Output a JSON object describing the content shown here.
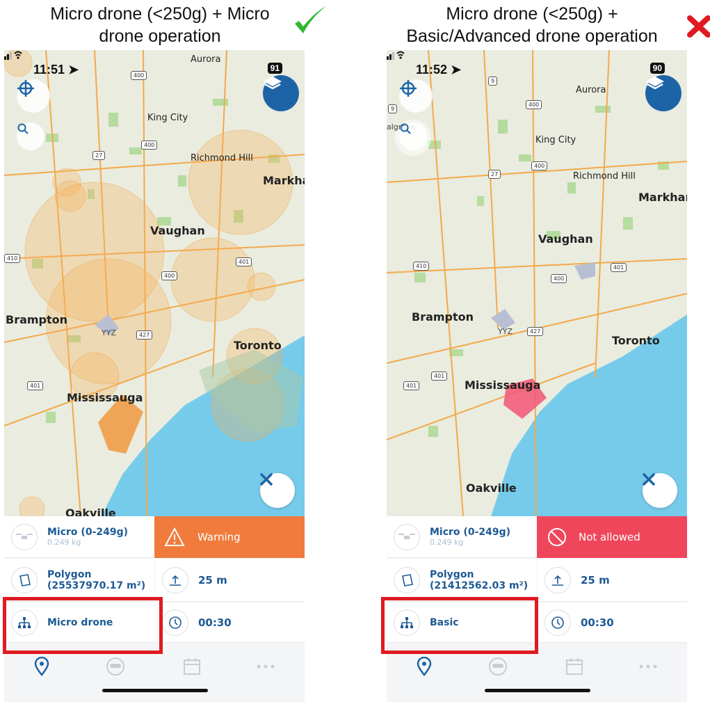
{
  "captions": {
    "left": "Micro drone (<250g) + Micro drone operation",
    "right": "Micro drone (<250g) + Basic/Advanced drone operation"
  },
  "colors": {
    "accent_blue": "#1d64a6",
    "label_blue": "#1d5a94",
    "warning_orange": "#f07b3c",
    "not_allowed_red": "#f0465c",
    "highlight_red": "#e01a22",
    "check_green": "#2eb82e",
    "water": "#76cbea",
    "land": "#e9ecdf"
  },
  "left_phone": {
    "status": {
      "time": "11:51",
      "battery": "91"
    },
    "map": {
      "cities": [
        "Aurora",
        "King City",
        "Richmond Hill",
        "Markha",
        "Vaughan",
        "Brampton",
        "Toronto",
        "Mississauga",
        "Oakville"
      ],
      "airport": "YYZ",
      "shields": [
        "400",
        "400",
        "27",
        "401",
        "400",
        "427",
        "401",
        "410"
      ]
    },
    "panel": {
      "drone_title": "Micro (0-249g)",
      "drone_weight": "0.249 kg",
      "status_label": "Warning",
      "area_title": "Polygon",
      "area_value": "(25537970.17 m²)",
      "altitude": "25 m",
      "operation": "Micro drone",
      "duration": "00:30"
    }
  },
  "right_phone": {
    "status": {
      "time": "11:52",
      "battery": "90"
    },
    "map": {
      "cities": [
        "Aurora",
        "algrave",
        "King City",
        "Richmond Hill",
        "Markham",
        "Vaughan",
        "Brampton",
        "Toronto",
        "Mississauga",
        "Oakville"
      ],
      "airport": "YYZ",
      "shields": [
        "9",
        "9",
        "400",
        "400",
        "27",
        "410",
        "401",
        "400",
        "427",
        "401",
        "401"
      ]
    },
    "panel": {
      "drone_title": "Micro (0-249g)",
      "drone_weight": "0.249 kg",
      "status_label": "Not allowed",
      "area_title": "Polygon",
      "area_value": "(21412562.03 m²)",
      "altitude": "25 m",
      "operation": "Basic",
      "duration": "00:30"
    }
  }
}
